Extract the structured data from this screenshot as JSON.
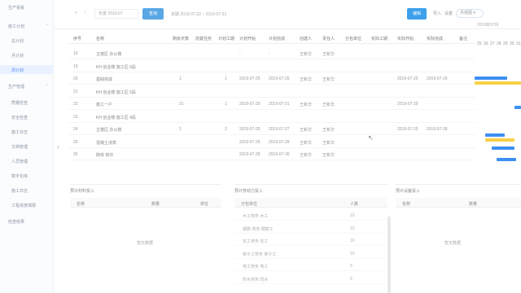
{
  "sidebar": {
    "items": [
      {
        "label": "生产看板"
      },
      {
        "label": "施工计划"
      },
      {
        "label": "总计划"
      },
      {
        "label": "周计划"
      },
      {
        "label": "月计划"
      },
      {
        "label": "生产管理"
      },
      {
        "label": "质量检查"
      },
      {
        "label": "安全检查"
      },
      {
        "label": "施工日志"
      },
      {
        "label": "文档管理"
      },
      {
        "label": "人员管理"
      },
      {
        "label": "数字化库"
      },
      {
        "label": "施工日志"
      },
      {
        "label": "工程进度填报"
      },
      {
        "label": "检查结果"
      }
    ]
  },
  "topbar": {
    "arrows": "« ‹",
    "date": "年度 2019-07",
    "query_label": "查询",
    "range_label": "本期 2019-07-22 ~ 2019-07-31",
    "edit_label": "编辑",
    "link_1": "导入",
    "link_2": "设置",
    "pill_label": "月视图 ▾"
  },
  "table": {
    "headers": [
      "序号",
      "名称",
      "剩余天数",
      "前置任务",
      "计划工期",
      "计划开始",
      "计划完成",
      "创建人",
      "责任人",
      "分包单位",
      "实际工期",
      "实际开始",
      "实际完成",
      "备注"
    ],
    "rows": [
      {
        "no": "10",
        "name": "主楼区 办公楼",
        "days": "",
        "pre": "",
        "dur": "",
        "start": "-",
        "end": "-",
        "creator": "王新华",
        "owner": "王新华",
        "sub": "",
        "adur": "",
        "astart": "",
        "aend": ""
      },
      {
        "no": "19",
        "name": "KH 创业楼 施工区 6段",
        "days": "",
        "pre": "",
        "dur": "",
        "start": "",
        "end": "",
        "creator": "",
        "owner": "",
        "sub": "",
        "adur": "",
        "astart": "",
        "aend": ""
      },
      {
        "no": "20",
        "name": "基础完成",
        "days": "1",
        "pre": "",
        "dur": "1",
        "start": "2019-07-25",
        "end": "2019-07-25",
        "creator": "王新华",
        "owner": "王新华",
        "sub": "",
        "adur": "",
        "astart": "2019-07-25",
        "aend": "2019-07-29"
      },
      {
        "no": "21",
        "name": "KH 创业楼 施工区 5段",
        "days": "",
        "pre": "",
        "dur": "",
        "start": "",
        "end": "",
        "creator": "",
        "owner": "",
        "sub": "",
        "adur": "",
        "astart": "",
        "aend": ""
      },
      {
        "no": "22",
        "name": "施工一户",
        "days": "21",
        "pre": "",
        "dur": "1",
        "start": "2019-07-29",
        "end": "2019-07-31",
        "creator": "王新华",
        "owner": "王新华",
        "sub": "",
        "adur": "",
        "astart": "2019-07-29",
        "aend": ""
      },
      {
        "no": "23",
        "name": "KH 创业楼 施工区 4段",
        "days": "",
        "pre": "",
        "dur": "",
        "start": "",
        "end": "",
        "creator": "",
        "owner": "",
        "sub": "",
        "adur": "",
        "astart": "",
        "aend": ""
      },
      {
        "no": "24",
        "name": "主楼区 办公楼",
        "days": "2",
        "pre": "",
        "dur": "2",
        "start": "2019-07-25",
        "end": "2019-07-27",
        "creator": "王新华",
        "owner": "王新华",
        "sub": "",
        "adur": "",
        "astart": "2019-07-25",
        "aend": "2019-07-28"
      },
      {
        "no": "25",
        "name": "混凝土浇筑",
        "days": "",
        "pre": "",
        "dur": "",
        "start": "2019-07-26",
        "end": "2019-07-29",
        "creator": "王新华",
        "owner": "王新华",
        "sub": "",
        "adur": "",
        "astart": "",
        "aend": ""
      },
      {
        "no": "26",
        "name": "砌体 抹灰",
        "days": "",
        "pre": "",
        "dur": "",
        "start": "2019-07-26",
        "end": "2019-07-30",
        "creator": "王新华",
        "owner": "王新华",
        "sub": "",
        "adur": "",
        "astart": "",
        "aend": ""
      }
    ]
  },
  "gantt": {
    "label": "2019年07月",
    "days": [
      "25",
      "26",
      "27",
      "28",
      "29",
      "30",
      "31"
    ],
    "colors": {
      "blue": "#3d8ff2",
      "yellow": "#f7d046"
    }
  },
  "panels": {
    "material": {
      "title": "预计材料投入",
      "col1": "名称",
      "col2": "数量",
      "col3": "单位",
      "empty": "暂无数据"
    },
    "labor": {
      "title": "预计劳动力投入",
      "col1": "分包单位",
      "col2": "人数",
      "rows": [
        {
          "name": "木工劳务 木工",
          "count": "10"
        },
        {
          "name": "钢筋 劳务 钢筋工",
          "count": "10"
        },
        {
          "name": "瓦工劳务 瓦工",
          "count": "10"
        },
        {
          "name": "架子工劳务 架子工",
          "count": "10"
        },
        {
          "name": "电工劳务 电工",
          "count": "5"
        },
        {
          "name": "防水劳务 防水",
          "count": "5"
        }
      ]
    },
    "equipment": {
      "title": "预计设备投入",
      "col1": "名称",
      "col2": "数量",
      "empty": "暂无数据"
    }
  }
}
